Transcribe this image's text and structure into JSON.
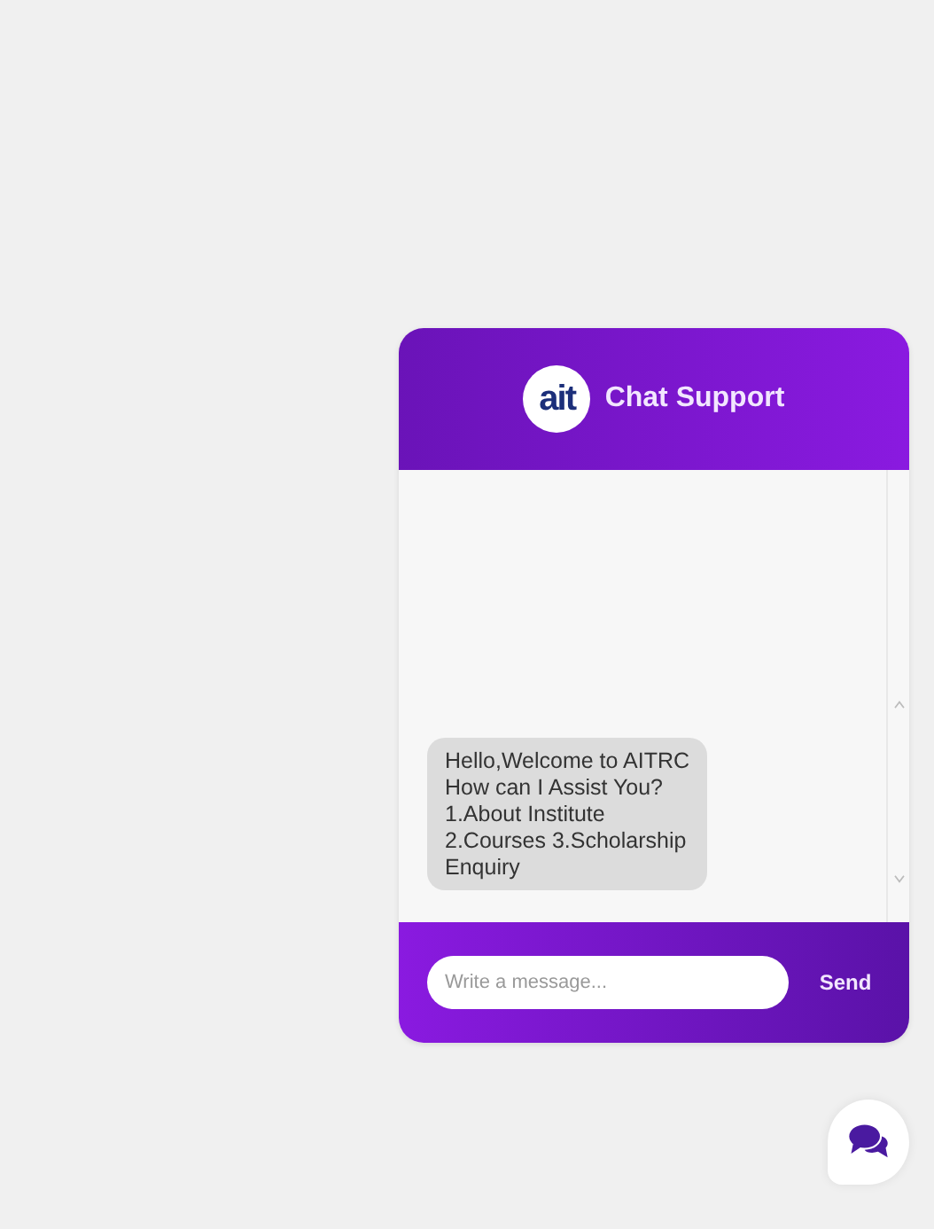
{
  "chat_window": {
    "logo": "ait",
    "title": "Chat Support",
    "messages": [
      {
        "kind": "bot",
        "text": "Hello,Welcome to AITRC\nHow can I Assist You?\n1.About Institute\n2.Courses 3.Scholarship\nEnquiry"
      }
    ],
    "input": {
      "placeholder": "Write a message..."
    },
    "send_button": "Send"
  }
}
